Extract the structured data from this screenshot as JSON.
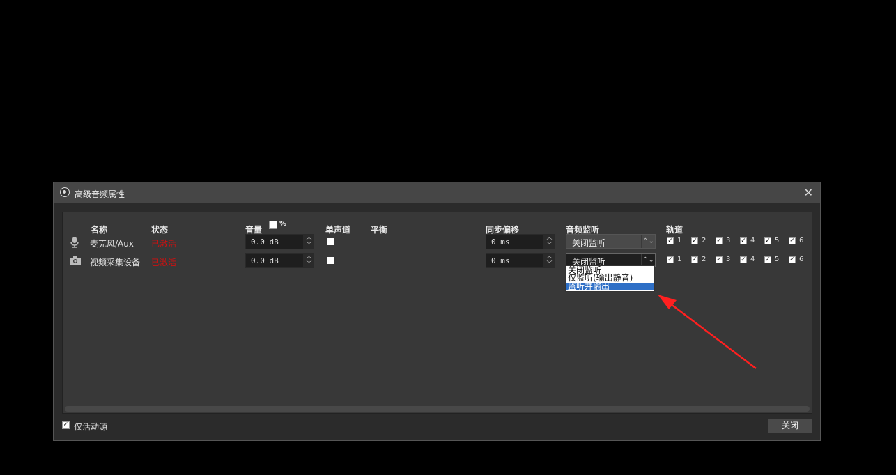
{
  "dialog": {
    "title": "高级音频属性",
    "headers": {
      "name": "名称",
      "status": "状态",
      "volume": "音量",
      "volume_pct": "%",
      "mono": "单声道",
      "balance": "平衡",
      "sync_offset": "同步偏移",
      "monitoring": "音频监听",
      "tracks": "轨道"
    },
    "rows": [
      {
        "icon": "microphone-icon",
        "name": "麦克风/Aux",
        "status": "已激活",
        "volume": "0.0 dB",
        "sync": "0 ms",
        "monitor": "关闭监听"
      },
      {
        "icon": "camera-icon",
        "name": "视频采集设备",
        "status": "已激活",
        "volume": "0.0 dB",
        "sync": "0 ms",
        "monitor": "关闭监听"
      }
    ],
    "track_numbers": [
      "1",
      "2",
      "3",
      "4",
      "5",
      "6"
    ],
    "monitor_options": [
      "关闭监听",
      "仅监听(输出静音)",
      "监听并输出"
    ],
    "selected_option": "监听并输出",
    "active_only_label": "仅活动源",
    "close_button": "关闭"
  },
  "colors": {
    "status_red": "#d01010",
    "selection_blue": "#2e6fc6",
    "arrow_red": "#ff2020"
  }
}
